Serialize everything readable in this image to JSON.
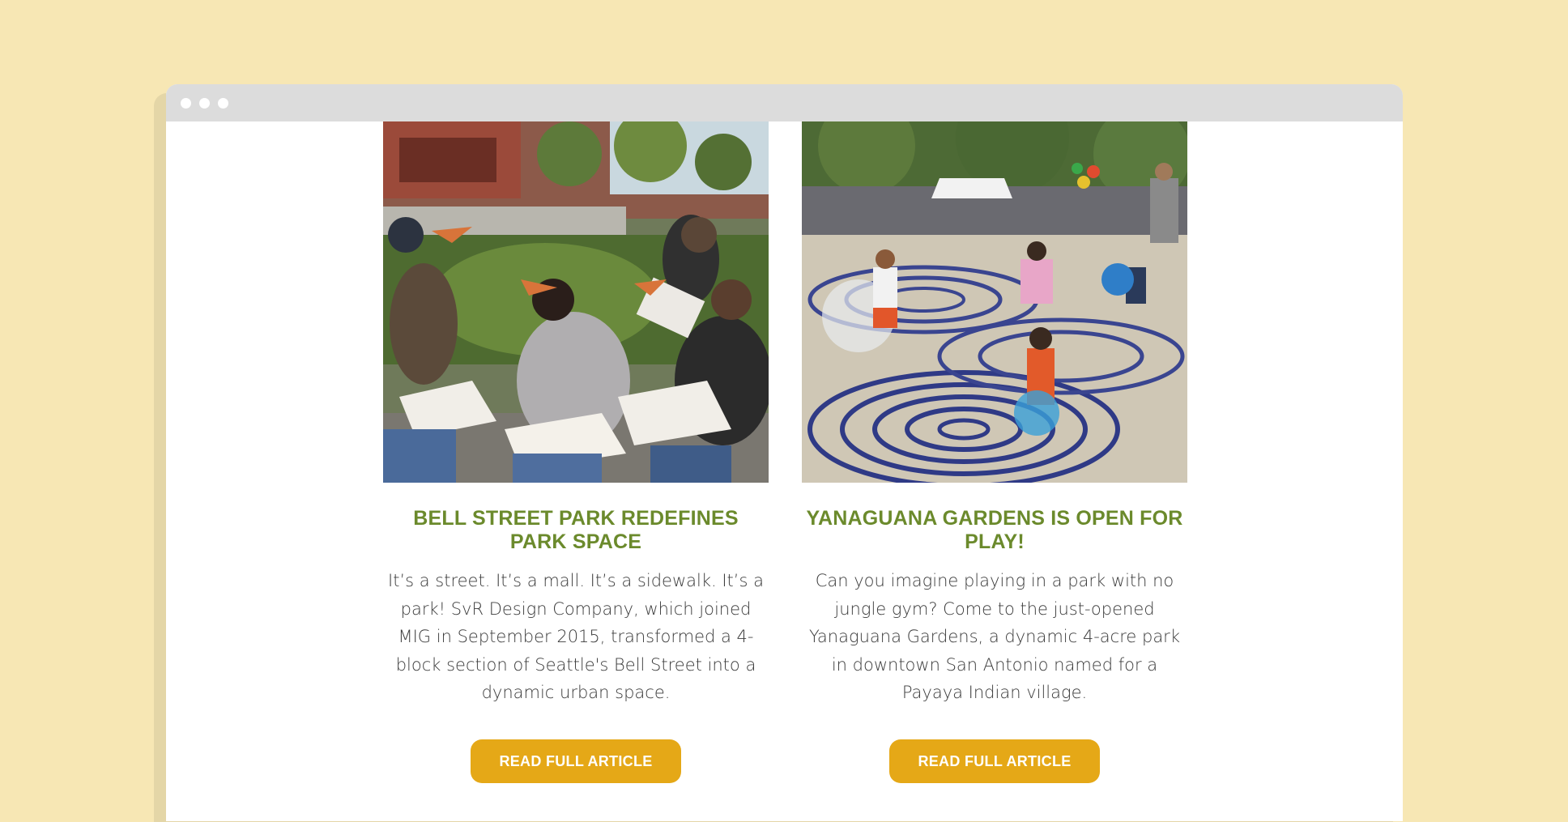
{
  "colors": {
    "background": "#f7e7b4",
    "title_green": "#6b8a2c",
    "button_gold": "#e5a817",
    "titlebar": "#dcdcdc"
  },
  "articles": [
    {
      "image": "photo of four young women eating pizza on a park bench",
      "title": "BELL STREET PARK REDEFINES PARK SPACE",
      "body": "It’s a street. It’s a mall. It’s a sidewalk. It’s a park! SvR Design Company, which joined MIG in September 2015, transformed a 4-block section of Seattle's Bell Street into a dynamic urban space.",
      "button_label": "READ FULL ARTICLE"
    },
    {
      "image": "photo of children playing in a splash pad with spiral patterns",
      "title": "YANAGUANA GARDENS IS OPEN FOR PLAY!",
      "body": "Can you imagine playing in a park with no jungle gym? Come to the just-opened Yanaguana Gardens, a dynamic 4-acre park in downtown San Antonio named for a Payaya Indian village.",
      "button_label": "READ FULL ARTICLE"
    }
  ]
}
